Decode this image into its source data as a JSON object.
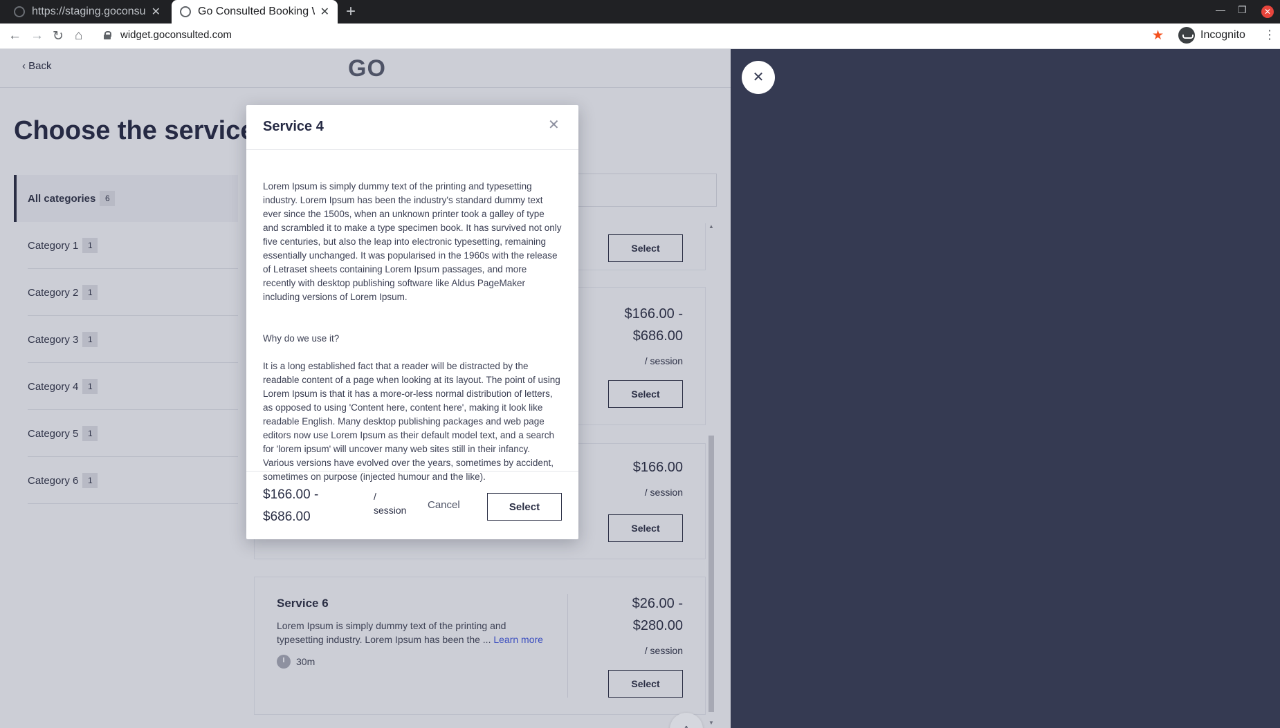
{
  "browser": {
    "tabs": [
      {
        "title": "https://staging.goconsult"
      },
      {
        "title": "Go Consulted Booking W"
      }
    ],
    "url": "widget.goconsulted.com",
    "profile_label": "Incognito"
  },
  "header": {
    "back_label": "Back",
    "logo": "GO"
  },
  "page_title": "Choose the service",
  "categories": [
    {
      "label": "All categories",
      "count": "6"
    },
    {
      "label": "Category 1",
      "count": "1"
    },
    {
      "label": "Category 2",
      "count": "1"
    },
    {
      "label": "Category 3",
      "count": "1"
    },
    {
      "label": "Category 4",
      "count": "1"
    },
    {
      "label": "Category 5",
      "count": "1"
    },
    {
      "label": "Category 6",
      "count": "1"
    }
  ],
  "services": [
    {
      "price_line1": "",
      "price_line2": "",
      "per": "",
      "select_label": "Select"
    },
    {
      "price_line1": "$166.00 -",
      "price_line2": "$686.00",
      "per": "/ session",
      "select_label": "Select"
    },
    {
      "price_line1": "$166.00",
      "price_line2": "",
      "per": "/ session",
      "select_label": "Select"
    },
    {
      "name": "Service 6",
      "description": "Lorem Ipsum is simply dummy text of the printing and typesetting industry. Lorem Ipsum has been the ...",
      "learn_more": "Learn more",
      "duration": "30m",
      "price_line1": "$26.00 -",
      "price_line2": "$280.00",
      "per": "/ session",
      "select_label": "Select"
    }
  ],
  "modal": {
    "title": "Service 4",
    "paragraph1": "Lorem Ipsum is simply dummy text of the printing and typesetting industry. Lorem Ipsum has been the industry's standard dummy text ever since the 1500s, when an unknown printer took a galley of type and scrambled it to make a type specimen book. It has survived not only five centuries, but also the leap into electronic typesetting, remaining essentially unchanged. It was popularised in the 1960s with the release of Letraset sheets containing Lorem Ipsum passages, and more recently with desktop publishing software like Aldus PageMaker including versions of Lorem Ipsum.",
    "heading2": "Why do we use it?",
    "paragraph2": "It is a long established fact that a reader will be distracted by the readable content of a page when looking at its layout. The point of using Lorem Ipsum is that it has a more-or-less normal distribution of letters, as opposed to using 'Content here, content here', making it look like readable English. Many desktop publishing packages and web page editors now use Lorem Ipsum as their default model text, and a search for 'lorem ipsum' will uncover many web sites still in their infancy. Various versions have evolved over the years, sometimes by accident, sometimes on purpose (injected humour and the like).",
    "price_line1": "$166.00 -",
    "price_line2": "$686.00",
    "per_line1": "/",
    "per_line2": "session",
    "cancel_label": "Cancel",
    "select_label": "Select"
  },
  "colors": {
    "page_bg": "#ccced6",
    "side_panel_bg": "#353a52",
    "primary_text": "#2b2f45",
    "link": "#3a4dbf",
    "bookmark_star": "#f4511e"
  },
  "icons": [
    "back-arrow-icon",
    "forward-arrow-icon",
    "reload-icon",
    "home-icon",
    "lock-icon",
    "star-icon",
    "incognito-icon",
    "menu-icon",
    "chevron-left-icon",
    "close-icon",
    "clock-icon",
    "arrow-up-icon"
  ]
}
